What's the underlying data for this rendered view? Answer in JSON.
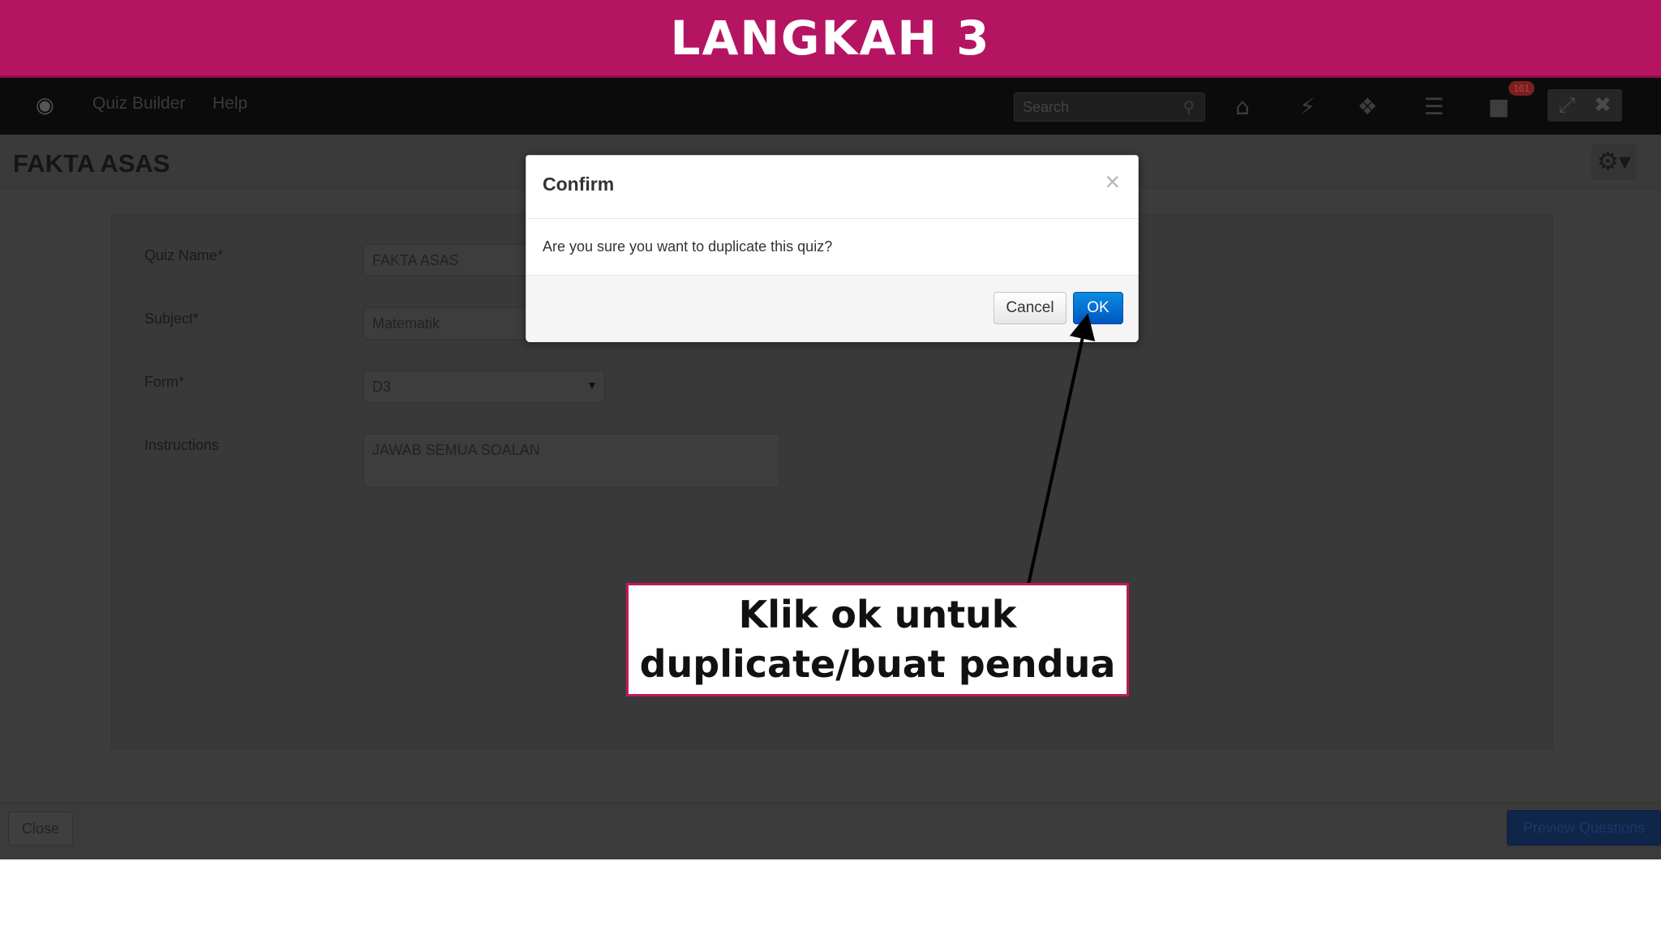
{
  "banner": {
    "title": "LANGKAH 3"
  },
  "nav": {
    "app_name": "Quiz Builder",
    "help": "Help",
    "search_placeholder": "Search",
    "badge_count": "161"
  },
  "page": {
    "title": "FAKTA ASAS"
  },
  "form": {
    "quiz_name_label": "Quiz Name*",
    "quiz_name_value": "FAKTA ASAS",
    "subject_label": "Subject*",
    "subject_value": "Matematik",
    "form_label": "Form*",
    "form_value": "D3",
    "instructions_label": "Instructions",
    "instructions_value": "JAWAB SEMUA SOALAN"
  },
  "footer": {
    "close_label": "Close",
    "preview_label": "Preview Questions"
  },
  "modal": {
    "title": "Confirm",
    "close_glyph": "×",
    "message": "Are you sure you want to duplicate this quiz?",
    "cancel_label": "Cancel",
    "ok_label": "OK"
  },
  "callout": {
    "text": "Klik ok untuk\nduplicate/buat pendua"
  },
  "icons": {
    "logo": "owl-logo-icon",
    "search": "search-icon",
    "home": "home-icon",
    "lightning": "lightning-icon",
    "puzzle": "puzzle-icon",
    "sliders": "sliders-icon",
    "chat": "chat-icon",
    "expand": "expand-icon",
    "close": "close-icon",
    "gear": "gear-icon"
  },
  "colors": {
    "banner": "#b51463",
    "callout_border": "#c2185b",
    "ok_button": "#0a6fd6"
  }
}
